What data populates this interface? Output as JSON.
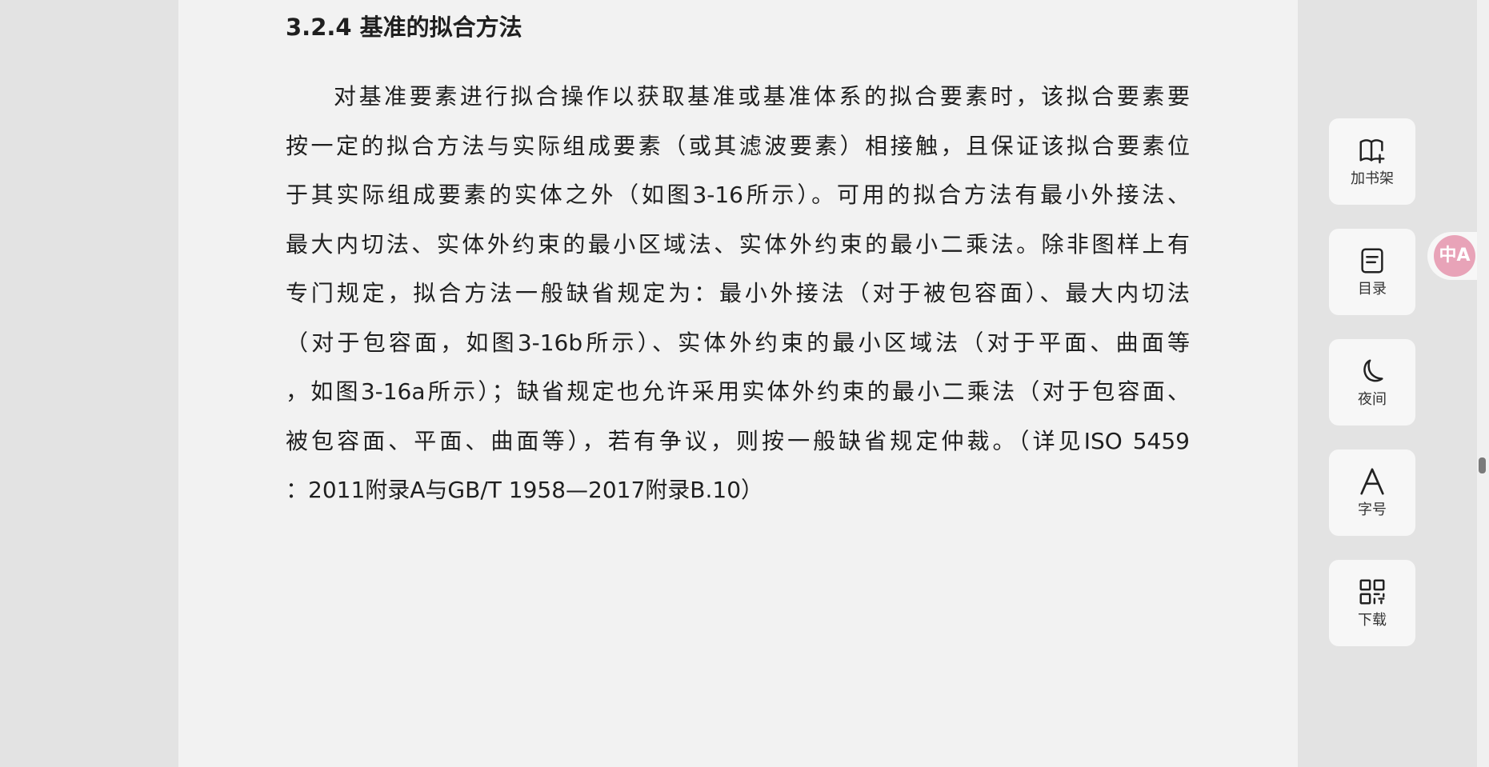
{
  "section": {
    "title": "3.2.4 基准的拟合方法",
    "lines": [
      "对基准要素进行拟合操作以获取基准或基准体系的拟合要素时，该拟合要素要",
      "按一定的拟合方法与实际组成要素（或其滤波要素）相接触，且保证该拟合要素位",
      "于其实际组成要素的实体之外（如图3-16所示）。可用的拟合方法有最小外接法、",
      "最大内切法、实体外约束的最小区域法、实体外约束的最小二乘法。除非图样上有",
      "专门规定，拟合方法一般缺省规定为：最小外接法（对于被包容面）、最大内切法",
      "（对于包容面，如图3-16b所示）、实体外约束的最小区域法（对于平面、曲面等",
      "，如图3-16a所示）；缺省规定也允许采用实体外约束的最小二乘法（对于包容面、",
      "被包容面、平面、曲面等），若有争议，则按一般缺省规定仲裁。（详见ISO 5459",
      "：2011附录A与GB/T 1958—2017附录B.10）"
    ]
  },
  "toolbar": {
    "bookshelf": {
      "label": "加书架",
      "icon": "add-bookshelf-icon"
    },
    "toc": {
      "label": "目录",
      "icon": "table-of-contents-icon"
    },
    "night": {
      "label": "夜间",
      "icon": "moon-icon"
    },
    "font": {
      "label": "字号",
      "icon": "font-size-icon"
    },
    "download": {
      "label": "下载",
      "icon": "qr-code-icon"
    }
  },
  "translate": {
    "icon": "translate-icon",
    "glyph": "中A",
    "color": "#e8a3b8"
  },
  "colors": {
    "page_background": "#f2f2f2",
    "outer_background": "#e3e3e3",
    "text": "#1f1f1f"
  }
}
